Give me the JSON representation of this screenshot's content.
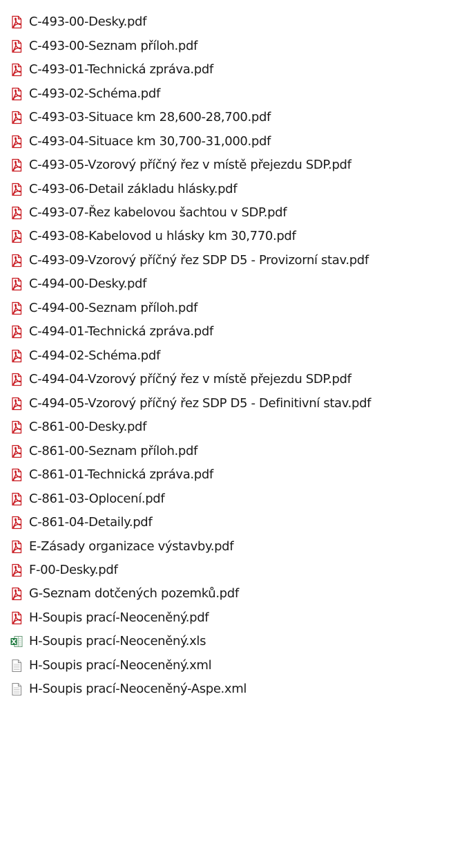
{
  "files": [
    {
      "name": "C-493-00-Desky.pdf",
      "icon": "pdf-icon"
    },
    {
      "name": "C-493-00-Seznam příloh.pdf",
      "icon": "pdf-icon"
    },
    {
      "name": "C-493-01-Technická zpráva.pdf",
      "icon": "pdf-icon"
    },
    {
      "name": "C-493-02-Schéma.pdf",
      "icon": "pdf-icon"
    },
    {
      "name": "C-493-03-Situace km 28,600-28,700.pdf",
      "icon": "pdf-icon"
    },
    {
      "name": "C-493-04-Situace km 30,700-31,000.pdf",
      "icon": "pdf-icon"
    },
    {
      "name": "C-493-05-Vzorový příčný řez v místě přejezdu SDP.pdf",
      "icon": "pdf-icon"
    },
    {
      "name": "C-493-06-Detail základu hlásky.pdf",
      "icon": "pdf-icon"
    },
    {
      "name": "C-493-07-Řez kabelovou šachtou v SDP.pdf",
      "icon": "pdf-icon"
    },
    {
      "name": "C-493-08-Kabelovod u hlásky km 30,770.pdf",
      "icon": "pdf-icon"
    },
    {
      "name": "C-493-09-Vzorový příčný řez SDP D5 - Provizorní stav.pdf",
      "icon": "pdf-icon"
    },
    {
      "name": "C-494-00-Desky.pdf",
      "icon": "pdf-icon"
    },
    {
      "name": "C-494-00-Seznam příloh.pdf",
      "icon": "pdf-icon"
    },
    {
      "name": "C-494-01-Technická zpráva.pdf",
      "icon": "pdf-icon"
    },
    {
      "name": "C-494-02-Schéma.pdf",
      "icon": "pdf-icon"
    },
    {
      "name": "C-494-04-Vzorový příčný řez v místě přejezdu SDP.pdf",
      "icon": "pdf-icon"
    },
    {
      "name": "C-494-05-Vzorový příčný řez SDP D5 - Definitivní stav.pdf",
      "icon": "pdf-icon"
    },
    {
      "name": "C-861-00-Desky.pdf",
      "icon": "pdf-icon"
    },
    {
      "name": "C-861-00-Seznam příloh.pdf",
      "icon": "pdf-icon"
    },
    {
      "name": "C-861-01-Technická zpráva.pdf",
      "icon": "pdf-icon"
    },
    {
      "name": "C-861-03-Oplocení.pdf",
      "icon": "pdf-icon"
    },
    {
      "name": "C-861-04-Detaily.pdf",
      "icon": "pdf-icon"
    },
    {
      "name": "E-Zásady organizace výstavby.pdf",
      "icon": "pdf-icon"
    },
    {
      "name": "F-00-Desky.pdf",
      "icon": "pdf-icon"
    },
    {
      "name": "G-Seznam dotčených pozemků.pdf",
      "icon": "pdf-icon"
    },
    {
      "name": "H-Soupis prací-Neoceněný.pdf",
      "icon": "pdf-icon"
    },
    {
      "name": "H-Soupis prací-Neoceněný.xls",
      "icon": "excel-icon"
    },
    {
      "name": "H-Soupis prací-Neoceněný.xml",
      "icon": "text-file-icon"
    },
    {
      "name": "H-Soupis prací-Neoceněný-Aspe.xml",
      "icon": "text-file-icon"
    }
  ],
  "colors": {
    "pdf_red": "#c8171e",
    "excel_green": "#1f7a3f",
    "doc_gray": "#8a8a8a"
  }
}
